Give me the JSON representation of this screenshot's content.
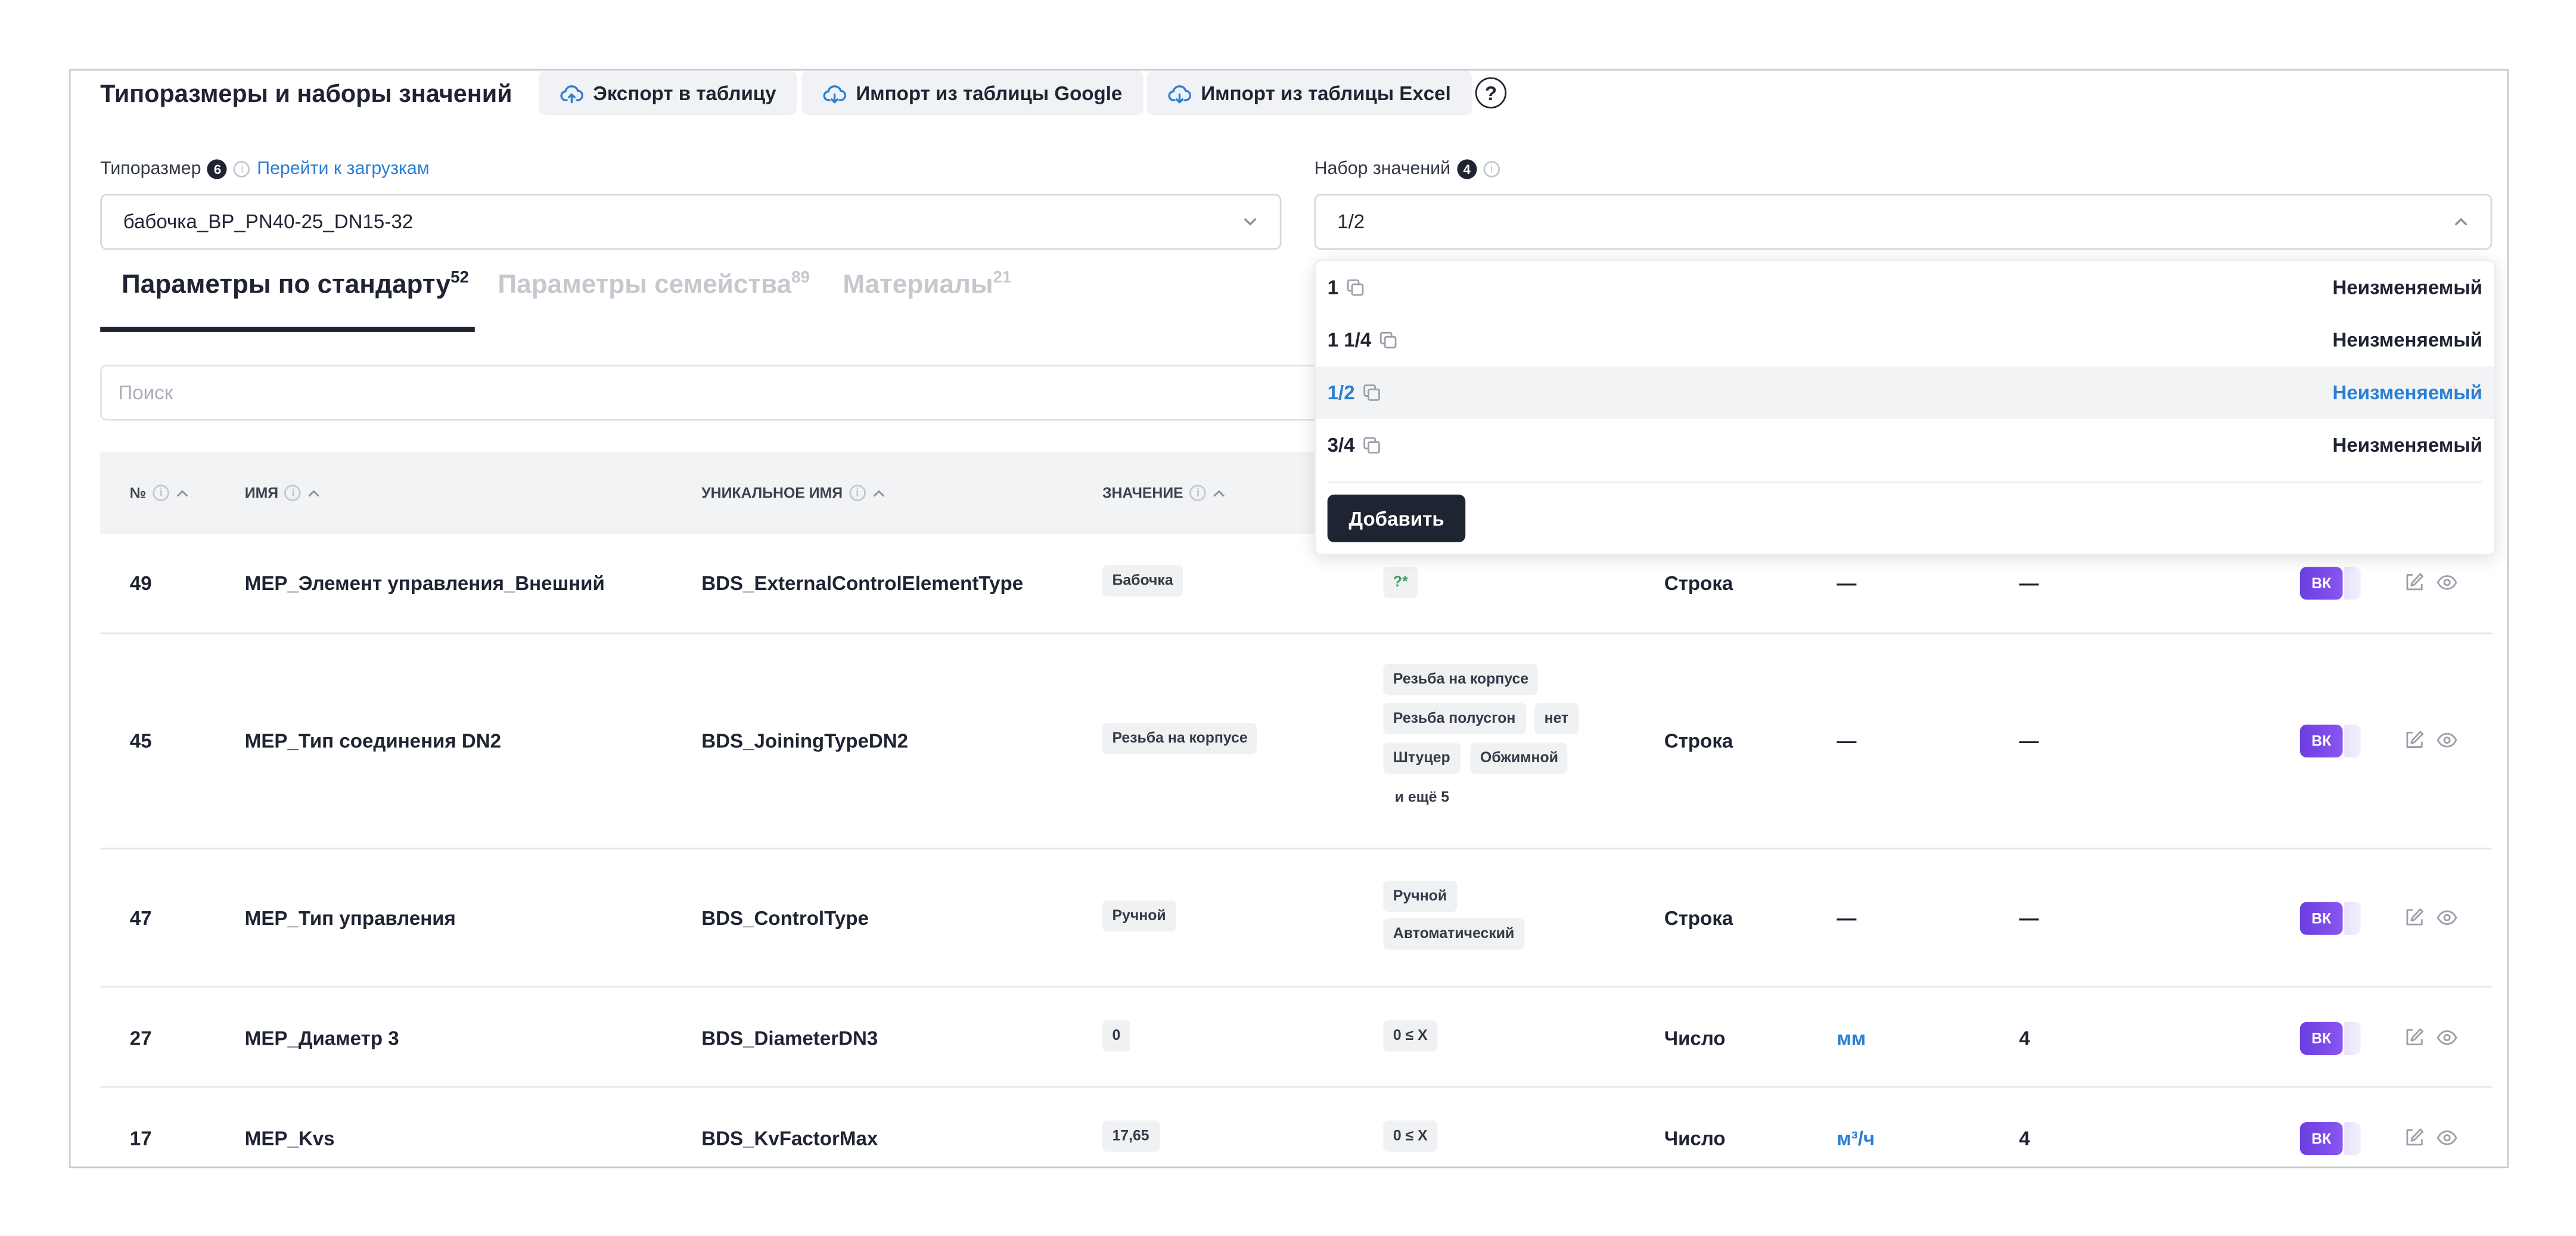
{
  "header": {
    "title": "Типоразмеры и наборы значений",
    "export_label": "Экспорт в таблицу",
    "import_google_label": "Импорт из таблицы Google",
    "import_excel_label": "Импорт из таблицы Excel",
    "help_label": "?"
  },
  "typesize": {
    "label": "Типоразмер",
    "count": "6",
    "link": "Перейти к загрузкам",
    "value": "бабочка_BP_PN40-25_DN15-32"
  },
  "valueset": {
    "label": "Набор значений",
    "count": "4",
    "value": "1/2"
  },
  "tabs": [
    {
      "label": "Параметры по стандарту",
      "count": "52",
      "active": true
    },
    {
      "label": "Параметры семейства",
      "count": "89",
      "active": false
    },
    {
      "label": "Материалы",
      "count": "21",
      "active": false
    }
  ],
  "search": {
    "placeholder": "Поиск"
  },
  "table": {
    "headers": {
      "num": "№",
      "name": "ИМЯ",
      "unique": "УНИКАЛЬНОЕ ИМЯ",
      "value": "ЗНАЧЕНИЕ"
    },
    "rows": [
      {
        "num": "49",
        "name": "MEP_Элемент управления_Внешний",
        "unique": "BDS_ExternalControlElementType",
        "value": "Бабочка",
        "limits": [
          "?*"
        ],
        "type": "Строка",
        "unit": "—",
        "precision": "—",
        "badge": "ВК"
      },
      {
        "num": "45",
        "name": "MEP_Тип соединения DN2",
        "unique": "BDS_JoiningTypeDN2",
        "value": "Резьба на корпусе",
        "limits": [
          "Резьба на корпусе",
          "Резьба полусгон",
          "нет",
          "Штуцер",
          "Обжимной"
        ],
        "more": "и ещё 5",
        "type": "Строка",
        "unit": "—",
        "precision": "—",
        "badge": "ВК"
      },
      {
        "num": "47",
        "name": "MEP_Тип управления",
        "unique": "BDS_ControlType",
        "value": "Ручной",
        "limits": [
          "Ручной",
          "Автоматический"
        ],
        "type": "Строка",
        "unit": "—",
        "precision": "—",
        "badge": "ВК"
      },
      {
        "num": "27",
        "name": "MEP_Диаметр 3",
        "unique": "BDS_DiameterDN3",
        "value": "0",
        "limits": [
          "0 ≤ X"
        ],
        "type": "Число",
        "unit": "мм",
        "precision": "4",
        "badge": "ВК"
      },
      {
        "num": "17",
        "name": "MEP_Kvs",
        "unique": "BDS_KvFactorMax",
        "value": "17,65",
        "limits": [
          "0 ≤ X"
        ],
        "type": "Число",
        "unit": "м³/ч",
        "precision": "4",
        "badge": "ВК"
      }
    ]
  },
  "dropdown": {
    "options": [
      {
        "label": "1",
        "status": "Неизменяемый",
        "selected": false
      },
      {
        "label": "1 1/4",
        "status": "Неизменяемый",
        "selected": false
      },
      {
        "label": "1/2",
        "status": "Неизменяемый",
        "selected": true
      },
      {
        "label": "3/4",
        "status": "Неизменяемый",
        "selected": false
      }
    ],
    "add_label": "Добавить"
  },
  "colors": {
    "accent": "#2a7fd4",
    "dark": "#1f2433",
    "badge": "#6a3fe0"
  }
}
